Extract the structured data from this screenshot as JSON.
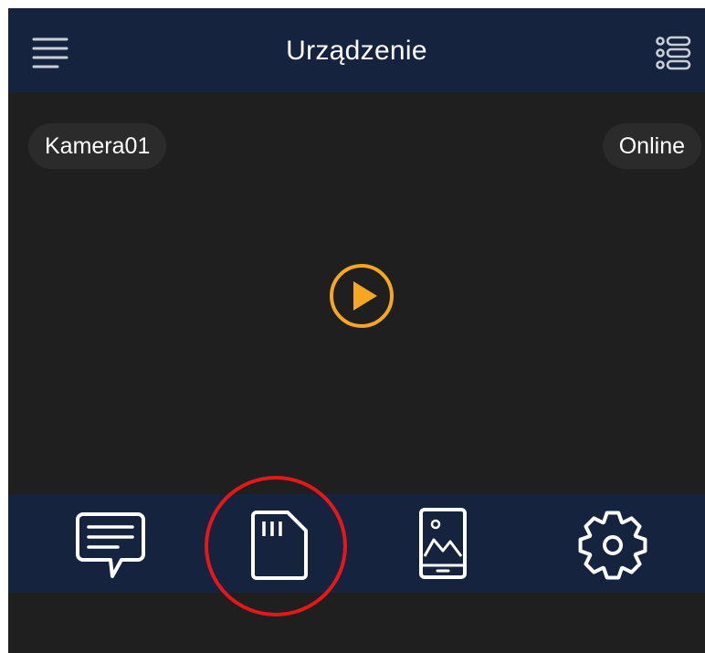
{
  "header": {
    "title": "Urządzenie",
    "menu_icon": "hamburger-menu-icon",
    "list_icon": "device-list-icon"
  },
  "video": {
    "camera_name": "Kamera01",
    "status": "Online",
    "play_icon": "play-icon"
  },
  "toolbar": {
    "items": [
      {
        "icon": "message-icon"
      },
      {
        "icon": "sd-card-icon"
      },
      {
        "icon": "phone-gallery-icon"
      },
      {
        "icon": "gear-icon"
      }
    ]
  },
  "annotation": {
    "highlighted_item": "sd-card-icon"
  },
  "colors": {
    "header_bg": "#15233f",
    "content_bg": "#1f1f1f",
    "accent": "#f5a623",
    "highlight": "#e41818"
  }
}
